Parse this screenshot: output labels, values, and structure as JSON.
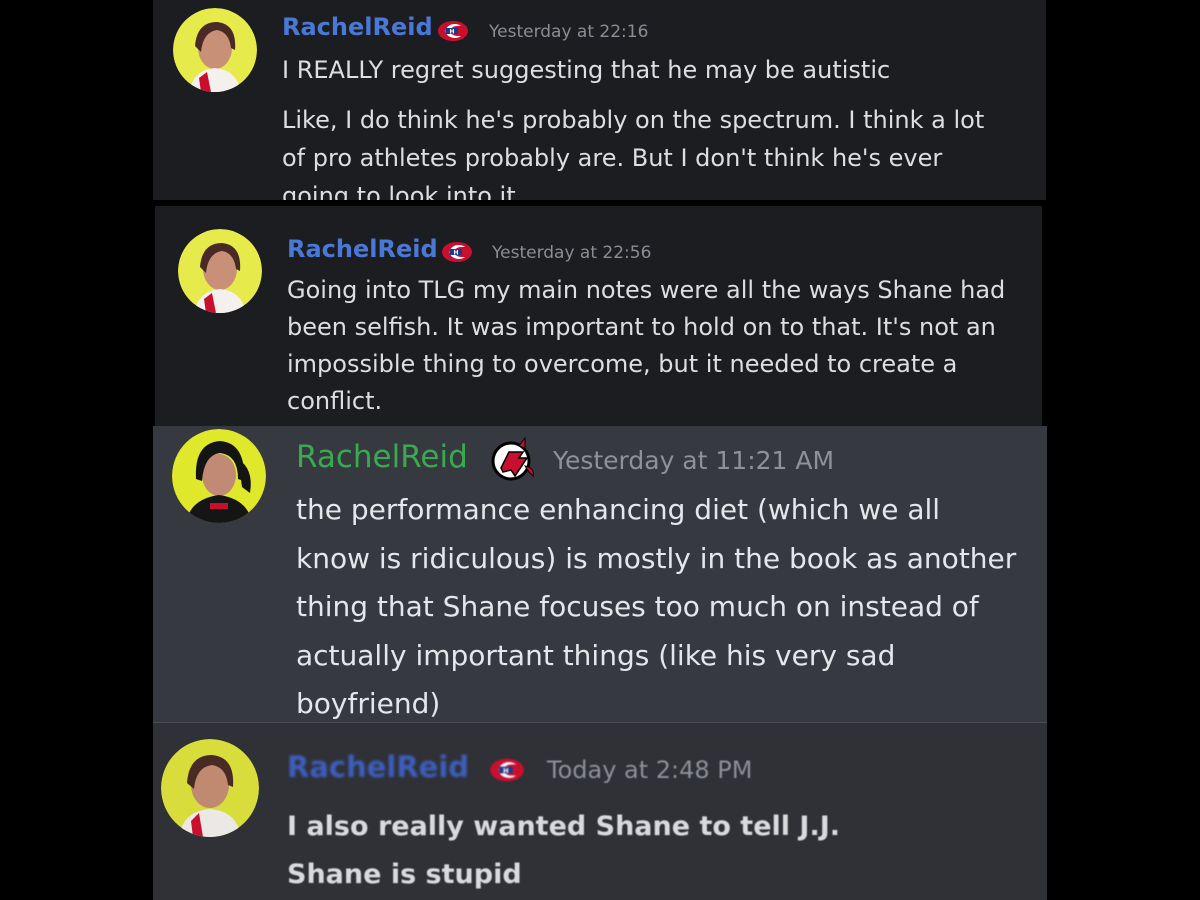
{
  "messages": [
    {
      "author": "RachelReid",
      "badge_icon": "canadiens-logo-icon",
      "timestamp": "Yesterday at 22:16",
      "paragraphs": [
        [
          "I REALLY regret suggesting that he may be autistic"
        ],
        [
          "Like, I do think he's probably on the spectrum. I think a lot",
          "of pro athletes probably are. But I don't think he's ever",
          "going to look into it."
        ]
      ]
    },
    {
      "author": "RachelReid",
      "badge_icon": "canadiens-logo-icon",
      "timestamp": "Yesterday at 22:56",
      "paragraphs": [
        [
          "Going into TLG my main notes were all the ways Shane had",
          "been selfish. It was important to hold on to that. It's not an",
          "impossible thing to overcome, but it needed to create a",
          "conflict."
        ]
      ]
    },
    {
      "author": "RachelReid",
      "badge_icon": "devils-logo-icon",
      "timestamp": "Yesterday at 11:21 AM",
      "paragraphs": [
        [
          "the performance enhancing diet (which we all",
          "know is ridiculous) is mostly in the book as another",
          "thing that Shane focuses too much on instead of",
          "actually important things (like his very sad",
          "boyfriend)"
        ]
      ]
    },
    {
      "author": "RachelReid",
      "badge_icon": "canadiens-logo-icon",
      "timestamp": "Today at 2:48 PM",
      "paragraphs": [
        [
          "I also really wanted Shane to tell J.J.",
          "Shane is stupid"
        ]
      ]
    }
  ],
  "colors": {
    "discord_dark": "#1c1d21",
    "discord_gray": "#36393f",
    "name_blue": "#4a78d6",
    "name_green": "#3aa94f",
    "canadiens_red": "#c8102e"
  }
}
